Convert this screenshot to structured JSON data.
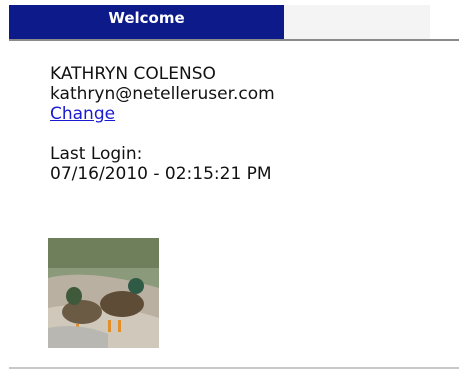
{
  "tabs": [
    {
      "label": "Welcome",
      "active": true
    }
  ],
  "user": {
    "name": "KATHRYN COLENSO",
    "email": "kathryn@netelleruser.com",
    "change_link": "Change"
  },
  "login": {
    "label": "Last Login:",
    "timestamp": "07/16/2010 - 02:15:21 PM"
  },
  "avatar": {
    "icon": "ducks-photo"
  },
  "colors": {
    "tab_active_bg": "#0d1a8a",
    "link": "#1a1ad0"
  }
}
